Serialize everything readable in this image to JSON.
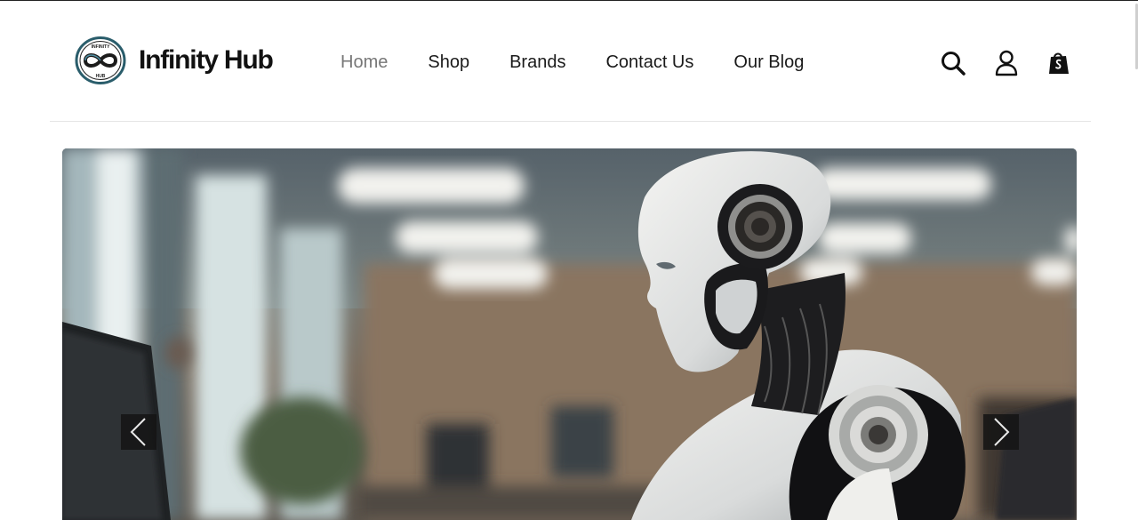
{
  "brand": {
    "name": "Infinity Hub",
    "logo_top_text": "INFINITY",
    "logo_bottom_text": "HUB"
  },
  "nav": {
    "items": [
      {
        "label": "Home",
        "active": true
      },
      {
        "label": "Shop",
        "active": false
      },
      {
        "label": "Brands",
        "active": false
      },
      {
        "label": "Contact Us",
        "active": false
      },
      {
        "label": "Our Blog",
        "active": false
      }
    ]
  },
  "header_actions": [
    {
      "icon": "search-icon"
    },
    {
      "icon": "user-icon"
    },
    {
      "icon": "shopping-bag-icon"
    }
  ],
  "hero_slider": {
    "slide_image": "white humanoid robot working at a computer in a blurred office",
    "prev_icon": "chevron-left-icon",
    "next_icon": "chevron-right-icon"
  },
  "colors": {
    "text": "#111111",
    "nav_active": "#777777",
    "arrow_bg": "#141414"
  }
}
